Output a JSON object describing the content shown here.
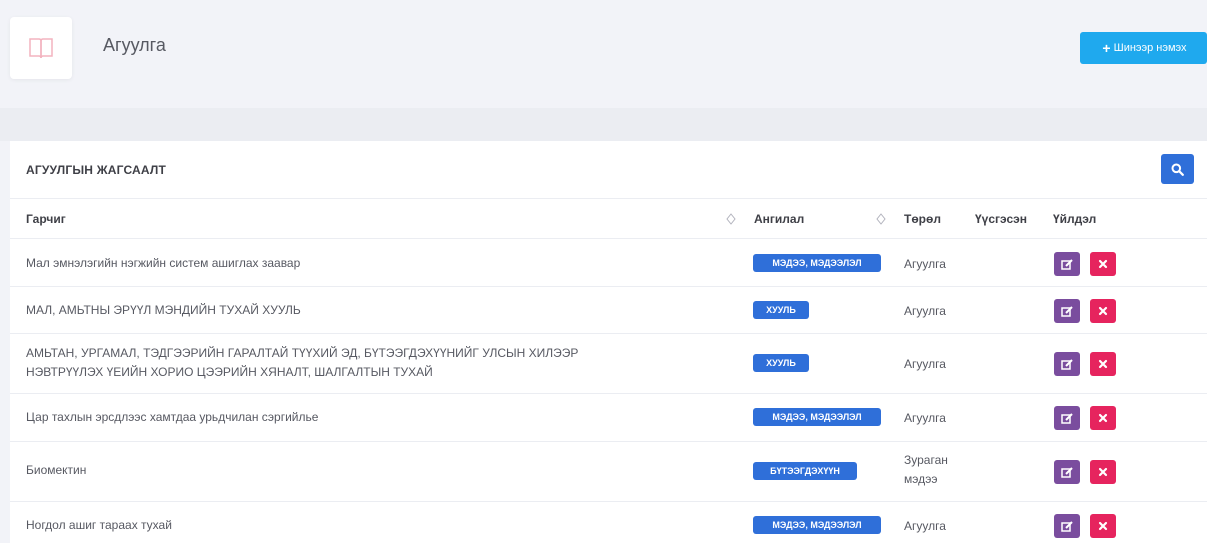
{
  "header": {
    "title": "Агуулга",
    "add_button_label": "Шинээр нэмэх"
  },
  "card": {
    "title": "АГУУЛГЫН ЖАГСААЛТ"
  },
  "table": {
    "columns": [
      "Гарчиг",
      "Ангилал",
      "Төрөл",
      "Үүсгэсэн",
      "Үйлдэл"
    ],
    "rows": [
      {
        "title": "Мал эмнэлэгийн нэгжийн систем ашиглах заавар",
        "category": "МЭДЭЭ, МЭДЭЭЛЭЛ",
        "type": "Агуулга"
      },
      {
        "title": "МАЛ, АМЬТНЫ ЭРҮҮЛ МЭНДИЙН ТУХАЙ ХУУЛЬ",
        "category": "ХУУЛЬ",
        "type": "Агуулга"
      },
      {
        "title": "АМЬТАН, УРГАМАЛ, ТЭДГЭЭРИЙН ГАРАЛТАЙ ТҮҮХИЙ ЭД, БҮТЭЭГДЭХҮҮНИЙГ УЛСЫН ХИЛЭЭР",
        "title_line2": "НЭВТРҮҮЛЭХ ҮЕИЙН ХОРИО ЦЭЭРИЙН ХЯНАЛТ, ШАЛГАЛТЫН ТУХАЙ",
        "category": "ХУУЛЬ",
        "type": "Агуулга"
      },
      {
        "title": "Цар тахлын эрсдлээс хамтдаа урьдчилан сэргийлье",
        "category": "МЭДЭЭ, МЭДЭЭЛЭЛ",
        "type": "Агуулга"
      },
      {
        "title": "Биомектин",
        "category": "БҮТЭЭГДЭХҮҮН",
        "type": "Зураган",
        "type_line2": "мэдээ"
      },
      {
        "title": "Ногдол ашиг тараах тухай",
        "category": "МЭДЭЭ, МЭДЭЭЛЭЛ",
        "type": "Агуулга"
      }
    ]
  },
  "colors": {
    "primary": "#2f6fd9",
    "accent": "#1fa9ee",
    "edit": "#7a4d9e",
    "delete": "#e6245e"
  },
  "icons": {
    "page": "book-icon",
    "search": "search-icon",
    "edit": "edit-icon",
    "delete": "close-icon"
  }
}
